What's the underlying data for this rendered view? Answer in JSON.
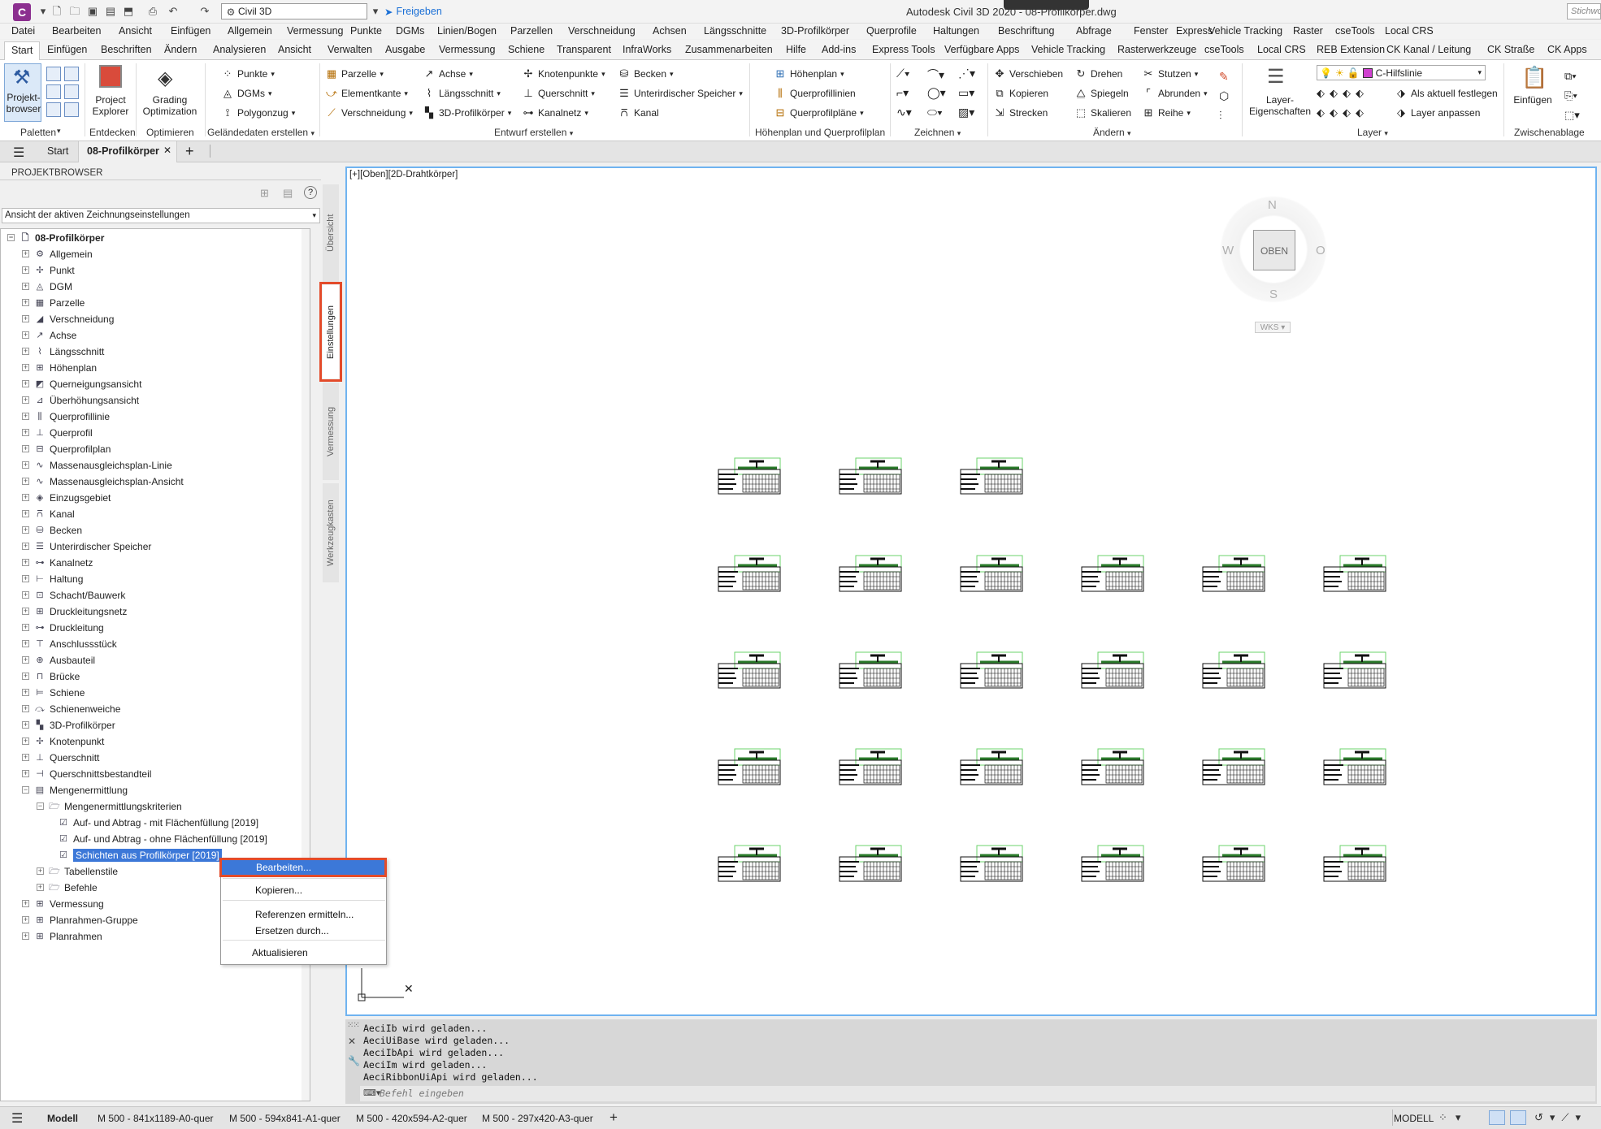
{
  "title": "Autodesk Civil 3D 2020 - 08-Profilkörper.dwg",
  "titlebar": {
    "app_letter": "C",
    "workspace": "Civil 3D",
    "share_label": "Freigeben",
    "search_placeholder": "Stichwo"
  },
  "menubar": [
    "Datei",
    "Bearbeiten",
    "Ansicht",
    "Einfügen",
    "Allgemein",
    "Vermessung",
    "Punkte",
    "DGMs",
    "Linien/Bogen",
    "Parzellen",
    "Verschneidung",
    "Achsen",
    "Längsschnitte",
    "3D-Profilkörper",
    "Querprofile",
    "Haltungen",
    "Beschriftung",
    "Abfrage",
    "Fenster",
    "Express",
    "Vehicle Tracking",
    "Raster",
    "cseTools",
    "Local CRS"
  ],
  "ribbon_tabs": [
    "Start",
    "Einfügen",
    "Beschriften",
    "Ändern",
    "Analysieren",
    "Ansicht",
    "Verwalten",
    "Ausgabe",
    "Vermessung",
    "Schiene",
    "Transparent",
    "InfraWorks",
    "Zusammenarbeiten",
    "Hilfe",
    "Add-ins",
    "Express Tools",
    "Verfügbare Apps",
    "Vehicle Tracking",
    "Rasterwerkzeuge",
    "cseTools",
    "Local CRS",
    "REB Extension",
    "CK Kanal / Leitung",
    "CK Straße",
    "CK Apps"
  ],
  "ribbon": {
    "paletten": {
      "big1": "Projekt-\nbrowser",
      "title": "Paletten"
    },
    "entdecken": {
      "big": "Project\nExplorer",
      "title": "Entdecken"
    },
    "optimieren": {
      "big": "Grading\nOptimization",
      "title": "Optimieren"
    },
    "gelaende": {
      "items": [
        "Punkte",
        "DGMs",
        "Polygonzug"
      ],
      "title": "Geländedaten erstellen"
    },
    "entwurf": {
      "col1": [
        "Parzelle",
        "Elementkante",
        "Verschneidung"
      ],
      "col2": [
        "Achse",
        "Längsschnitt",
        "3D-Profilkörper"
      ],
      "col3": [
        "Knotenpunkte",
        "Querschnitt",
        "Kanalnetz"
      ],
      "col4": [
        "Becken",
        "Unterirdischer Speicher",
        "Kanal"
      ],
      "title": "Entwurf erstellen"
    },
    "hoehenplan": {
      "items": [
        "Höhenplan",
        "Querprofillinien",
        "Querprofilpläne"
      ],
      "title": "Höhenplan und Querprofilplan"
    },
    "zeichnen": {
      "title": "Zeichnen"
    },
    "aendern": {
      "col1": [
        "Verschieben",
        "Kopieren",
        "Strecken"
      ],
      "col2": [
        "Drehen",
        "Spiegeln",
        "Skalieren"
      ],
      "col3": [
        "Stutzen",
        "Abrunden",
        "Reihe"
      ],
      "title": "Ändern"
    },
    "layer": {
      "big": "Layer-\nEigenschaften",
      "layer_name": "C-Hilfslinie",
      "items": [
        "Als aktuell festlegen",
        "Layer anpassen"
      ],
      "title": "Layer"
    },
    "zwischenablage": {
      "big": "Einfügen",
      "title": "Zwischenablage"
    }
  },
  "doc_tabs": {
    "start": "Start",
    "active": "08-Profilkörper"
  },
  "browser": {
    "header": "PROJEKTBROWSER",
    "view_select": "Ansicht der aktiven Zeichnungseinstellungen",
    "root": "08-Profilkörper",
    "items": [
      "Allgemein",
      "Punkt",
      "DGM",
      "Parzelle",
      "Verschneidung",
      "Achse",
      "Längsschnitt",
      "Höhenplan",
      "Querneigungsansicht",
      "Überhöhungsansicht",
      "Querprofillinie",
      "Querprofil",
      "Querprofilplan",
      "Massenausgleichsplan-Linie",
      "Massenausgleichsplan-Ansicht",
      "Einzugsgebiet",
      "Kanal",
      "Becken",
      "Unterirdischer Speicher",
      "Kanalnetz",
      "Haltung",
      "Schacht/Bauwerk",
      "Druckleitungsnetz",
      "Druckleitung",
      "Anschlussstück",
      "Ausbauteil",
      "Brücke",
      "Schiene",
      "Schienenweiche",
      "3D-Profilkörper",
      "Knotenpunkt",
      "Querschnitt",
      "Querschnittsbestandteil",
      "Mengenermittlung"
    ],
    "sub1": "Mengenermittlungskriterien",
    "sub1_items": [
      "Auf- und Abtrag - mit Flächenfüllung [2019]",
      "Auf- und Abtrag - ohne Flächenfüllung [2019]",
      "Schichten aus Profilkörper [2019]"
    ],
    "sub2": [
      "Tabellenstile",
      "Befehle"
    ],
    "after": [
      "Vermessung",
      "Planrahmen-Gruppe",
      "Planrahmen"
    ],
    "vtabs": [
      "Übersicht",
      "Einstellungen",
      "Vermessung",
      "Werkzeugkasten"
    ]
  },
  "context_menu": [
    "Bearbeiten...",
    "Kopieren...",
    "Referenzen ermitteln...",
    "Ersetzen durch...",
    "Aktualisieren"
  ],
  "viewport": {
    "label": "[+][Oben][2D-Drahtkörper]",
    "cube": {
      "n": "N",
      "s": "S",
      "w": "W",
      "o": "O",
      "face": "OBEN",
      "wcs": "WKS"
    }
  },
  "command": {
    "lines": [
      "AeciIb wird geladen...",
      "AeciUiBase wird geladen...",
      "AeciIbApi wird geladen...",
      "AeciIm wird geladen...",
      "AeciRibbonUiApi wird geladen..."
    ],
    "placeholder": "Befehl eingeben"
  },
  "status": {
    "tabs": [
      "Modell",
      "M 500 - 841x1189-A0-quer",
      "M 500 - 594x841-A1-quer",
      "M 500 - 420x594-A2-quer",
      "M 500 - 297x420-A3-quer"
    ],
    "mode": "MODELL"
  },
  "colors": {
    "accent": "#6fb3f0",
    "highlight": "#e34b2a",
    "selection": "#3c78d8"
  }
}
